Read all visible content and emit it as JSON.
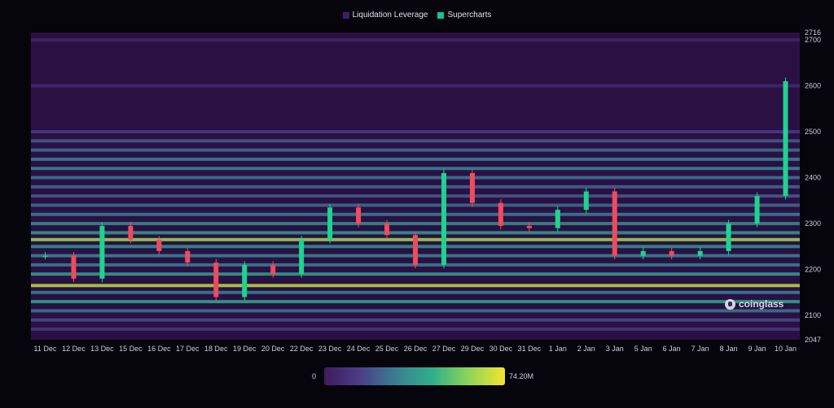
{
  "legend": {
    "items": [
      {
        "label": "Liquidation Leverage",
        "color": "#3b1f6b"
      },
      {
        "label": "Supercharts",
        "color": "#17c19a"
      }
    ]
  },
  "watermark": {
    "text": "coinglass"
  },
  "colorbar": {
    "min_label": "0",
    "max_label": "74.20M"
  },
  "colors": {
    "background": "#06050b",
    "heatmap_base": "#2a1043",
    "bull": "#1fd38f",
    "bear": "#f04a5e"
  },
  "chart_data": {
    "type": "heatmap",
    "title": "",
    "xlabel": "",
    "ylabel": "",
    "x_tick_labels": [
      "11 Dec",
      "12 Dec",
      "13 Dec",
      "15 Dec",
      "16 Dec",
      "17 Dec",
      "18 Dec",
      "19 Dec",
      "20 Dec",
      "22 Dec",
      "23 Dec",
      "24 Dec",
      "25 Dec",
      "26 Dec",
      "27 Dec",
      "29 Dec",
      "30 Dec",
      "31 Dec",
      "1 Jan",
      "2 Jan",
      "3 Jan",
      "5 Jan",
      "6 Jan",
      "7 Jan",
      "8 Jan",
      "9 Jan",
      "10 Jan"
    ],
    "y_ticks": [
      2047,
      2100,
      2200,
      2300,
      2400,
      2500,
      2600,
      2700,
      2716
    ],
    "ylim": [
      2047,
      2716
    ],
    "colorscale_range": [
      0,
      74.2
    ],
    "colorscale_unit": "M",
    "price_series": [
      {
        "date": "11 Dec",
        "close": 2230
      },
      {
        "date": "12 Dec",
        "close": 2180
      },
      {
        "date": "13 Dec",
        "close": 2295
      },
      {
        "date": "15 Dec",
        "close": 2265
      },
      {
        "date": "16 Dec",
        "close": 2240
      },
      {
        "date": "17 Dec",
        "close": 2215
      },
      {
        "date": "18 Dec",
        "close": 2140
      },
      {
        "date": "19 Dec",
        "close": 2210
      },
      {
        "date": "20 Dec",
        "close": 2190
      },
      {
        "date": "22 Dec",
        "close": 2265
      },
      {
        "date": "23 Dec",
        "close": 2335
      },
      {
        "date": "24 Dec",
        "close": 2300
      },
      {
        "date": "25 Dec",
        "close": 2275
      },
      {
        "date": "26 Dec",
        "close": 2210
      },
      {
        "date": "27 Dec",
        "close": 2410
      },
      {
        "date": "29 Dec",
        "close": 2345
      },
      {
        "date": "30 Dec",
        "close": 2295
      },
      {
        "date": "31 Dec",
        "close": 2290
      },
      {
        "date": "1 Jan",
        "close": 2330
      },
      {
        "date": "2 Jan",
        "close": 2370
      },
      {
        "date": "3 Jan",
        "close": 2230
      },
      {
        "date": "5 Jan",
        "close": 2240
      },
      {
        "date": "6 Jan",
        "close": 2230
      },
      {
        "date": "7 Jan",
        "close": 2240
      },
      {
        "date": "8 Jan",
        "close": 2300
      },
      {
        "date": "9 Jan",
        "close": 2360
      },
      {
        "date": "10 Jan",
        "close": 2610
      }
    ],
    "liquidation_levels": [
      {
        "price": 2700,
        "value": 4
      },
      {
        "price": 2600,
        "value": 6
      },
      {
        "price": 2500,
        "value": 14
      },
      {
        "price": 2480,
        "value": 22
      },
      {
        "price": 2460,
        "value": 26
      },
      {
        "price": 2440,
        "value": 30
      },
      {
        "price": 2420,
        "value": 32
      },
      {
        "price": 2400,
        "value": 28
      },
      {
        "price": 2380,
        "value": 24
      },
      {
        "price": 2360,
        "value": 22
      },
      {
        "price": 2340,
        "value": 26
      },
      {
        "price": 2320,
        "value": 30
      },
      {
        "price": 2300,
        "value": 34
      },
      {
        "price": 2280,
        "value": 38
      },
      {
        "price": 2265,
        "value": 62
      },
      {
        "price": 2250,
        "value": 36
      },
      {
        "price": 2230,
        "value": 32
      },
      {
        "price": 2210,
        "value": 30
      },
      {
        "price": 2190,
        "value": 40
      },
      {
        "price": 2165,
        "value": 66
      },
      {
        "price": 2150,
        "value": 30
      },
      {
        "price": 2130,
        "value": 42
      },
      {
        "price": 2110,
        "value": 28
      },
      {
        "price": 2090,
        "value": 18
      },
      {
        "price": 2070,
        "value": 12
      }
    ]
  }
}
